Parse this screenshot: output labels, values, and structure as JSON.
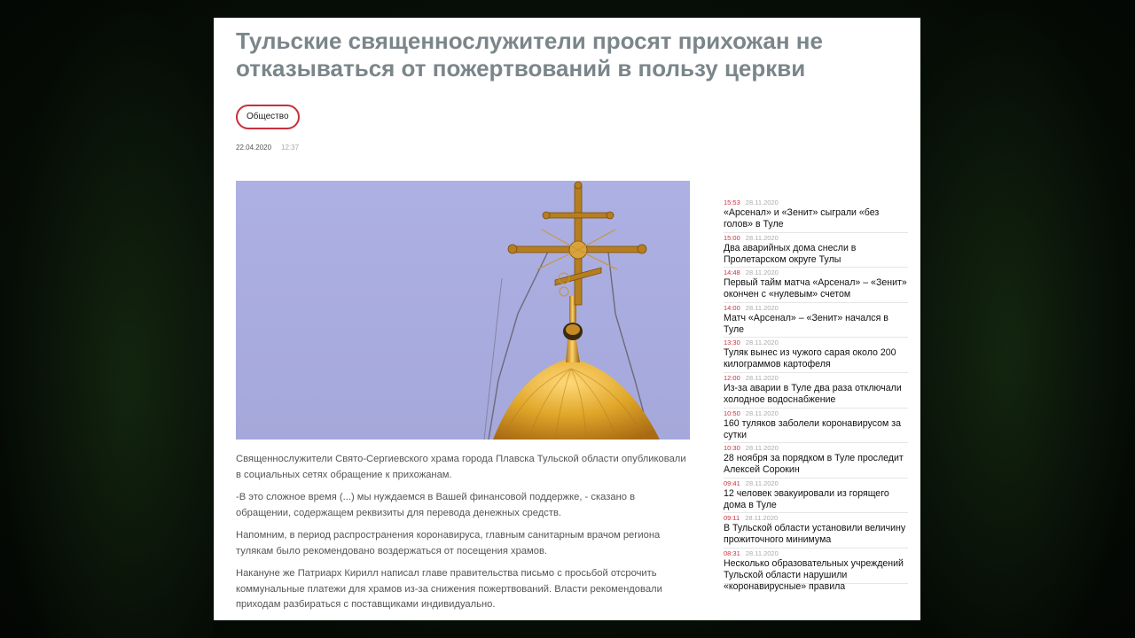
{
  "article": {
    "title": "Тульские священнослужители просят прихожан не отказываться от пожертвований в пользу церкви",
    "tag": "Общество",
    "date": "22.04.2020",
    "time": "12:37",
    "paragraphs": [
      "Священнослужители Свято-Сергиевского храма города Плавска Тульской области опубликовали в социальных сетях обращение к прихожанам.",
      "-В это сложное время (...) мы нуждаемся в Вашей финансовой поддержке, - сказано в обращении, содержащем реквизиты для перевода денежных средств.",
      "Напомним, в период распространения коронавируса, главным санитарным врачом региона тулякам было рекомендовано воздержаться от посещения храмов.",
      "Накануне же Патриарх Кирилл написал главе правительства письмо с просьбой отсрочить коммунальные платежи для храмов из-за снижения пожертвований. Власти рекомендовали приходам  разбираться с поставщиками индивидуально."
    ]
  },
  "colors": {
    "title": "#7b868a",
    "accent": "#c8303c",
    "sky": "#a9acdf",
    "dome": "#d9a126"
  },
  "news": [
    {
      "time": "15:53",
      "date": "28.11.2020",
      "title": "«Арсенал» и «Зенит» сыграли «без голов» в Туле"
    },
    {
      "time": "15:00",
      "date": "28.11.2020",
      "title": "Два аварийных дома снесли в Пролетарском округе Тулы"
    },
    {
      "time": "14:48",
      "date": "28.11.2020",
      "title": "Первый тайм матча «Арсенал» – «Зенит» окончен с «нулевым» счетом"
    },
    {
      "time": "14:00",
      "date": "28.11.2020",
      "title": "Матч «Арсенал» – «Зенит» начался в Туле"
    },
    {
      "time": "13:30",
      "date": "28.11.2020",
      "title": "Туляк вынес из чужого сарая около 200 килограммов картофеля"
    },
    {
      "time": "12:00",
      "date": "28.11.2020",
      "title": "Из-за аварии в Туле два раза отключали холодное водоснабжение"
    },
    {
      "time": "10:50",
      "date": "28.11.2020",
      "title": "160 туляков заболели коронавирусом за сутки"
    },
    {
      "time": "10:30",
      "date": "28.11.2020",
      "title": "28 ноября за порядком в Туле проследит Алексей Сорокин"
    },
    {
      "time": "09:41",
      "date": "28.11.2020",
      "title": "12 человек эвакуировали из горящего дома в Туле"
    },
    {
      "time": "09:11",
      "date": "28.11.2020",
      "title": "В Тульской области установили величину прожиточного минимума"
    },
    {
      "time": "08:31",
      "date": "28.11.2020",
      "title": "Несколько образовательных учреждений Тульской области нарушили «коронавирусные» правила"
    }
  ]
}
